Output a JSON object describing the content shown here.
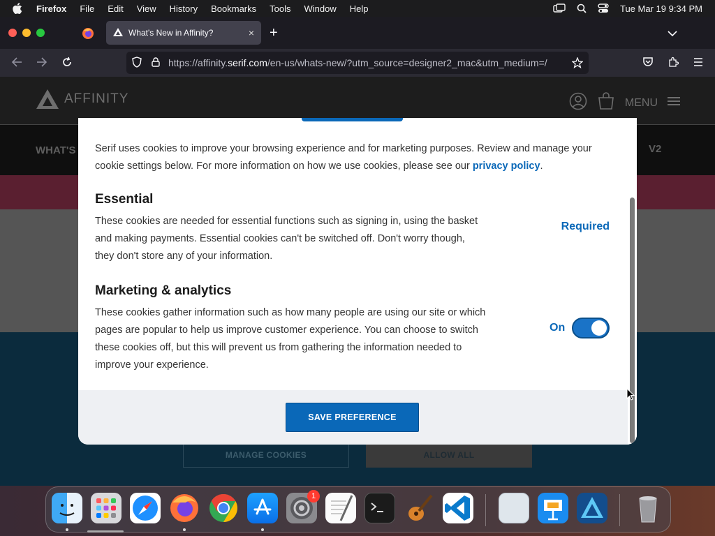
{
  "menubar": {
    "apple": "",
    "app_name": "Firefox",
    "items": [
      "File",
      "Edit",
      "View",
      "History",
      "Bookmarks",
      "Tools",
      "Window",
      "Help"
    ],
    "clock": "Tue Mar 19  9:34 PM"
  },
  "browser": {
    "tab_title": "What's New in Affinity?",
    "tab_close": "×",
    "new_tab": "+",
    "url_prefix": "https://affinity.",
    "url_domain": "serif.com",
    "url_suffix": "/en-us/whats-new/?utm_source=designer2_mac&utm_medium=/"
  },
  "site": {
    "logo_text": "AFFINITY",
    "menu_label": "MENU",
    "nav_left": "WHAT'S",
    "nav_right": "V2",
    "manage_cookies": "MANAGE COOKIES",
    "allow_all": "ALLOW ALL"
  },
  "modal": {
    "intro": "Serif uses cookies to improve your browsing experience and for marketing purposes. Review and manage your cookie settings below. For more information on how we use cookies, please see our ",
    "privacy_link": "privacy policy",
    "intro_end": ".",
    "essential_title": "Essential",
    "essential_body": "These cookies are needed for essential functions such as signing in, using the basket and making payments. Essential cookies can't be switched off. Don't worry though, they don't store any of your information.",
    "essential_status": "Required",
    "marketing_title": "Marketing & analytics",
    "marketing_body": "These cookies gather information such as how many people are using our site or which pages are popular to help us improve customer experience. You can choose to switch these cookies off, but this will prevent us from gathering the information needed to improve your experience.",
    "marketing_toggle_label": "On",
    "marketing_toggle_on": true,
    "save_button": "SAVE PREFERENCE"
  },
  "dock": {
    "settings_badge": "1",
    "icons": [
      "finder-icon",
      "launchpad-icon",
      "safari-icon",
      "firefox-icon",
      "chrome-icon",
      "app-store-icon",
      "system-settings-icon",
      "textedit-icon",
      "terminal-icon",
      "garageband-icon",
      "vscode-icon",
      "preview-icon",
      "keynote-icon",
      "affinity-designer-icon",
      "trash-icon"
    ]
  },
  "colors": {
    "accent": "#0a68b8",
    "menubar_bg": "#1c1c1e",
    "tab_bg": "#42414d"
  }
}
